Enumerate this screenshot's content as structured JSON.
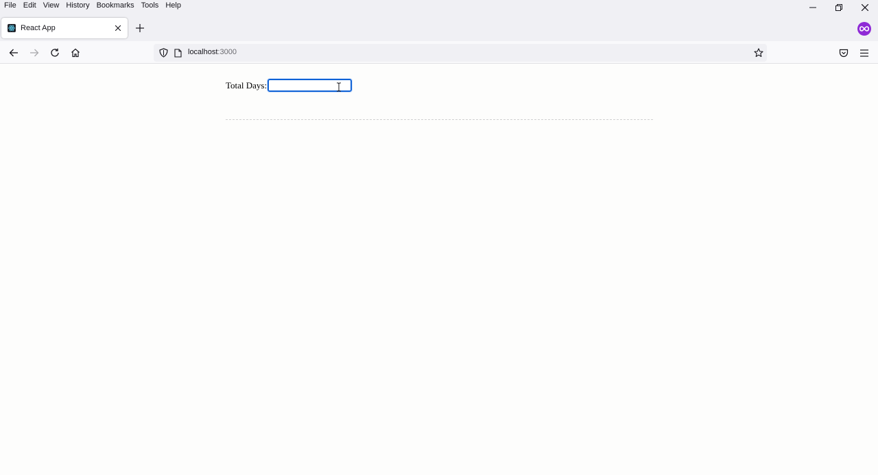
{
  "menubar": {
    "items": [
      "File",
      "Edit",
      "View",
      "History",
      "Bookmarks",
      "Tools",
      "Help"
    ]
  },
  "tabs": [
    {
      "title": "React App",
      "active": true
    }
  ],
  "navbar": {
    "url_host": "localhost",
    "url_port": ":3000"
  },
  "form": {
    "label": "Total Days:",
    "value": ""
  },
  "colors": {
    "accent": "#0f62d6",
    "extension": "#8f2ad6"
  }
}
